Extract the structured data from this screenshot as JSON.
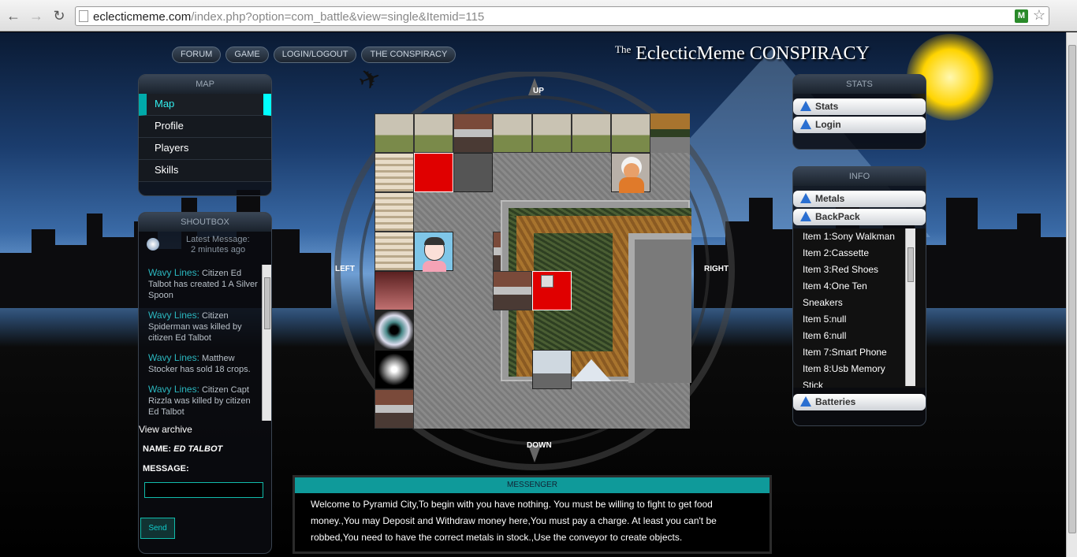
{
  "browser": {
    "url_host": "eclecticmeme.com",
    "url_path": "/index.php?option=com_battle&view=single&Itemid=115",
    "ext_label": "M"
  },
  "site": {
    "logo_small": "The",
    "logo_main": "EclecticMeme CONSPIRACY",
    "topmenu": [
      "FORUM",
      "GAME",
      "LOGIN/LOGOUT",
      "THE CONSPIRACY"
    ]
  },
  "map_panel": {
    "title": "MAP",
    "items": [
      "Map",
      "Profile",
      "Players",
      "Skills"
    ]
  },
  "shoutbox": {
    "title": "SHOUTBOX",
    "latest_label": "Latest Message:",
    "latest_time": "2 minutes ago",
    "entries": [
      {
        "who": "Wavy Lines:",
        "text": "Citizen Ed Talbot has created 1 A Silver Spoon"
      },
      {
        "who": "Wavy Lines:",
        "text": "Citizen Spiderman was killed by citizen Ed Talbot"
      },
      {
        "who": "Wavy Lines:",
        "text": "Matthew Stocker has sold 18 crops."
      },
      {
        "who": "Wavy Lines:",
        "text": "Citizen Capt Rizzla was killed by citizen Ed Talbot"
      }
    ],
    "archive": "View archive",
    "name_label": "NAME:",
    "name_value": "ED TALBOT",
    "message_label": "MESSAGE:",
    "message_value": "",
    "send": "Send"
  },
  "compass": {
    "up": "UP",
    "down": "DOWN",
    "left": "LEFT",
    "right": "RIGHT"
  },
  "stats_panel": {
    "title": "STATS",
    "items": [
      "Stats",
      "Login"
    ]
  },
  "info_panel": {
    "title": "INFO",
    "items": [
      "Metals",
      "BackPack",
      "Batteries"
    ],
    "backpack": [
      "Item 1:Sony Walkman",
      "Item 2:Cassette",
      "Item 3:Red Shoes",
      "Item 4:One Ten",
      "Sneakers",
      "Item 5:null",
      "Item 6:null",
      "Item 7:Smart Phone",
      "Item 8:Usb Memory",
      "Stick"
    ]
  },
  "messenger": {
    "title": "MESSENGER",
    "text": "Welcome to Pyramid City,To begin with you have nothing. You must be willing to fight to get food money.,You may Deposit and Withdraw money here,You must pay a charge. At least you can't be robbed,You need to have the correct metals in stock.,Use the conveyor to create objects."
  }
}
